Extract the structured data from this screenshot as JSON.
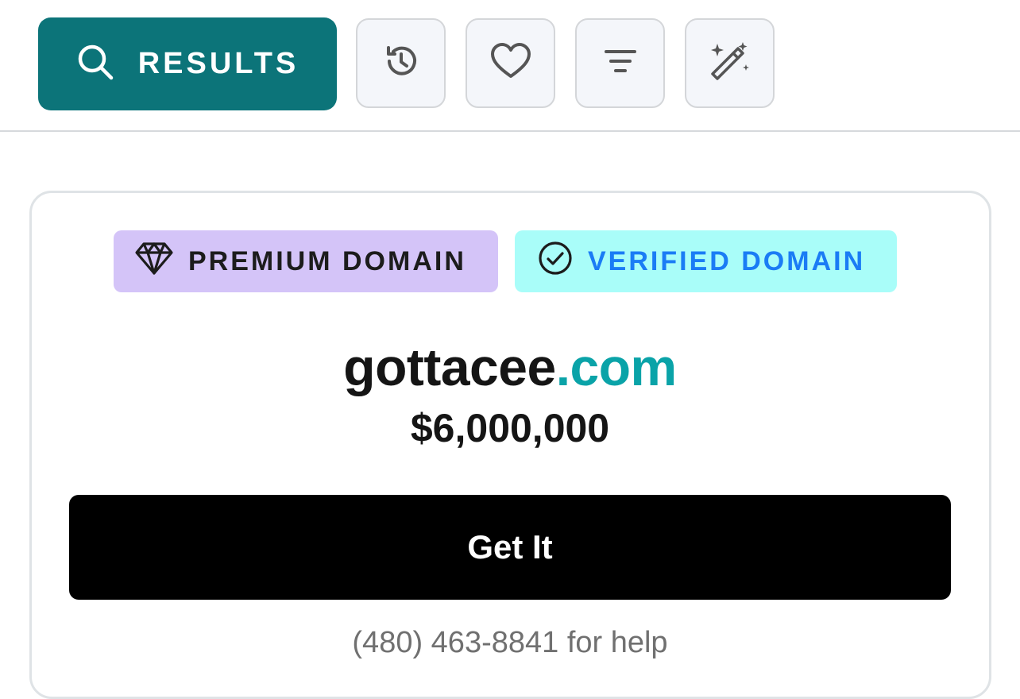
{
  "toolbar": {
    "results_label": "RESULTS",
    "icons": {
      "search": "search-icon",
      "history": "history-icon",
      "favorites": "heart-icon",
      "filter": "filter-icon",
      "magic": "magic-wand-icon"
    },
    "accent_color": "#0c7479"
  },
  "card": {
    "badges": {
      "premium": {
        "label": "PREMIUM DOMAIN",
        "icon": "diamond-icon",
        "bg": "#d4c4f8"
      },
      "verified": {
        "label": "VERIFIED DOMAIN",
        "icon": "check-circle-icon",
        "bg": "#a9fdf9",
        "color": "#1a7cf5"
      }
    },
    "domain": {
      "name": "gottacee",
      "tld": ".com",
      "tld_color": "#0aa3a8"
    },
    "price": "$6,000,000",
    "cta_label": "Get It",
    "help_text": "(480) 463-8841 for help"
  }
}
